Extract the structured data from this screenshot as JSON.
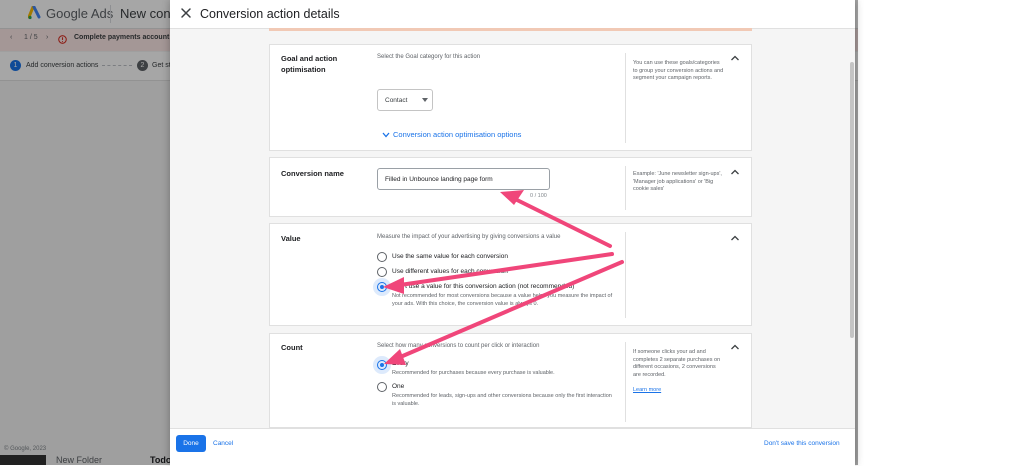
{
  "background": {
    "app_name": "Google Ads",
    "page_title": "New conve",
    "alert": {
      "pager": "1 / 5",
      "message": "Complete payments account activ"
    },
    "steps": [
      {
        "number": "1",
        "label": "Add conversion actions"
      },
      {
        "number": "2",
        "label": "Get st"
      }
    ],
    "footer": "© Google, 2023",
    "taskbar": [
      "New Folder",
      "Todo"
    ]
  },
  "panel": {
    "title": "Conversion action details",
    "goal_card": {
      "label": "Goal and action optimisation",
      "hint": "Select the Goal category for this action",
      "dropdown_value": "Contact",
      "link": "Conversion action optimisation options",
      "help": "You can use these goals/categories to group your conversion actions and segment your campaign reports."
    },
    "name_card": {
      "label": "Conversion name",
      "input_value": "Filled in Unbounce landing page form",
      "char_count": "0 / 100",
      "help": "Example: 'June newsletter sign-ups', 'Manager job applications' or 'Big cookie sales'"
    },
    "value_card": {
      "label": "Value",
      "hint": "Measure the impact of your advertising by giving conversions a value",
      "options": [
        {
          "label": "Use the same value for each conversion"
        },
        {
          "label": "Use different values for each conversion"
        },
        {
          "label": "Don't use a value for this conversion action (not recommended)",
          "sub": "Not recommended for most conversions because a value helps you measure the impact of your ads. With this choice, the conversion value is always 0."
        }
      ]
    },
    "count_card": {
      "label": "Count",
      "hint": "Select how many conversions to count per click or interaction",
      "options": [
        {
          "label": "Every",
          "sub": "Recommended for purchases because every purchase is valuable."
        },
        {
          "label": "One",
          "sub": "Recommended for leads, sign-ups and other conversions because only the first interaction is valuable."
        }
      ],
      "help": "If someone clicks your ad and completes 2 separate purchases on different occasions, 2 conversions are recorded.",
      "learn_more": "Learn more"
    },
    "footer": {
      "done": "Done",
      "cancel": "Cancel",
      "dont_save": "Don't save this conversion"
    }
  },
  "colors": {
    "primary": "#1a73e8",
    "annotation_arrow": "#f0467a"
  }
}
